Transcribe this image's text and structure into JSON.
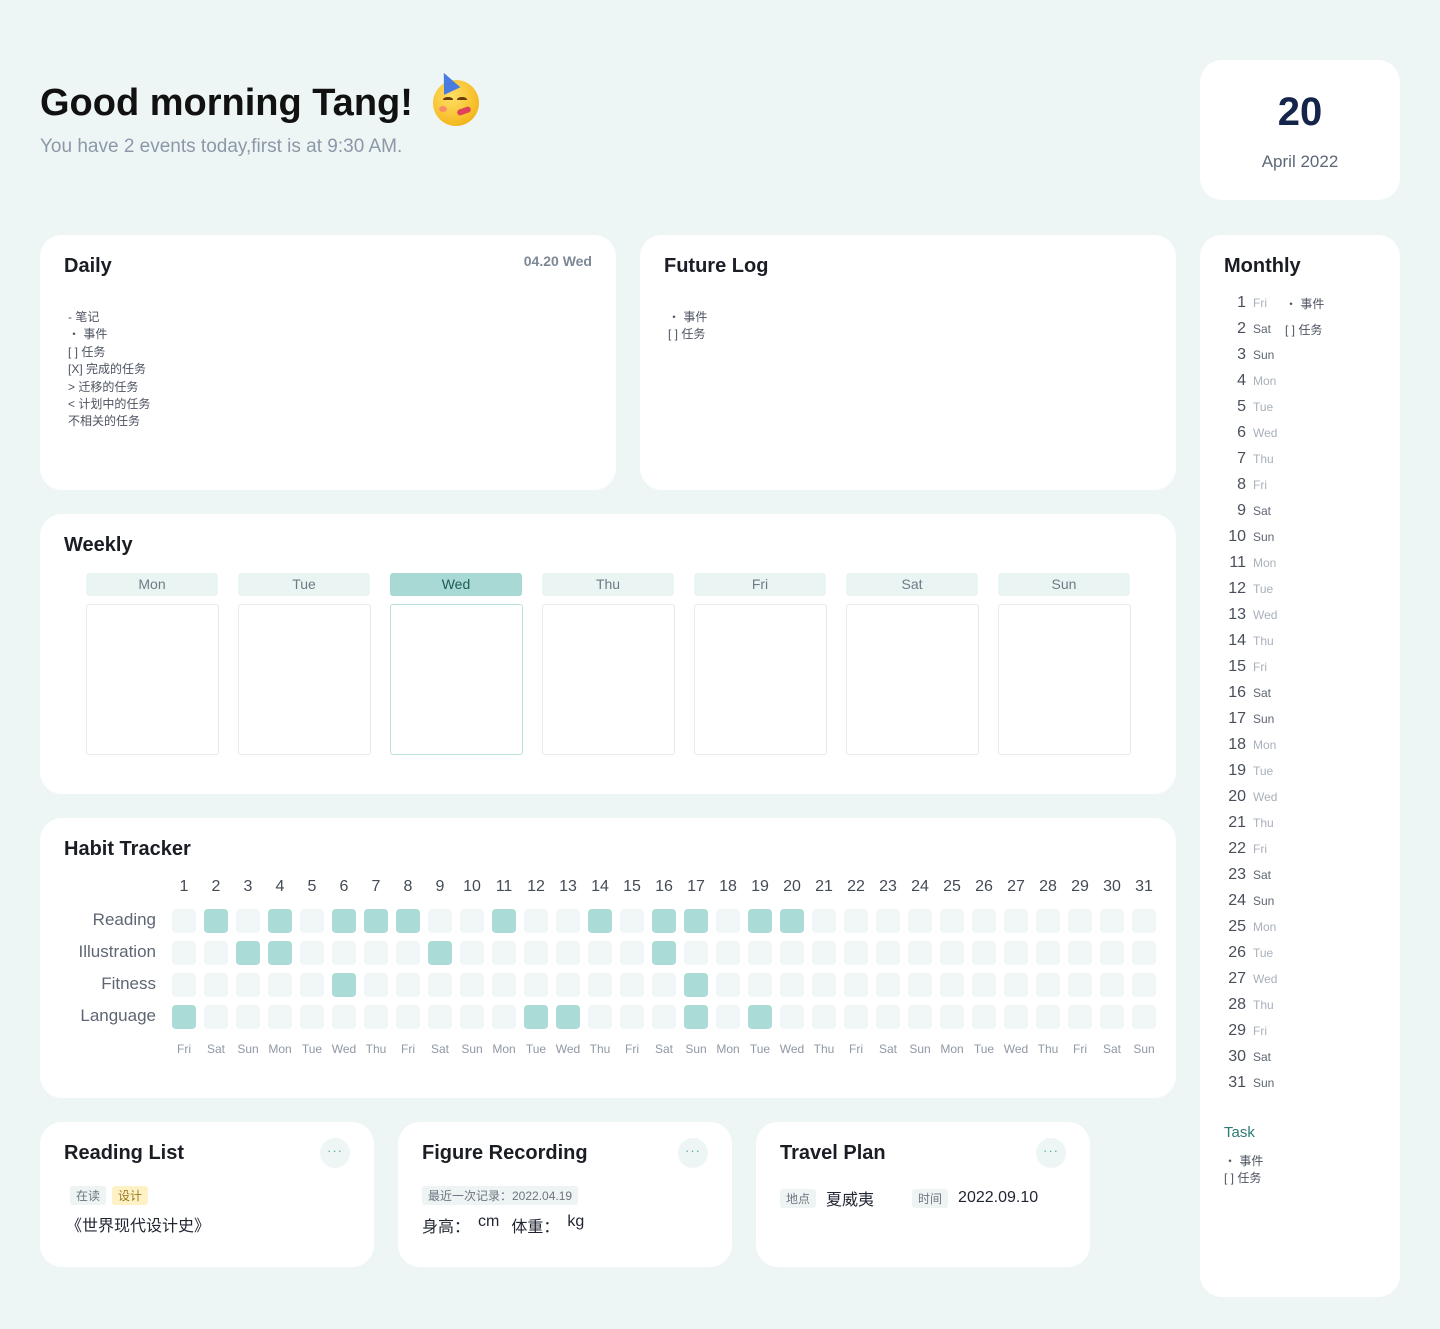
{
  "header": {
    "greeting": "Good morning Tang!",
    "subtitle": "You have 2 events today,first is at 9:30 AM.",
    "emoji": "partying-face"
  },
  "date_card": {
    "day": "20",
    "month": "April 2022"
  },
  "daily": {
    "title": "Daily",
    "date": "04.20 Wed",
    "lines": [
      "- 笔记",
      "・ 事件",
      "[ ] 任务",
      "[X] 完成的任务",
      "> 迁移的任务",
      "< 计划中的任务",
      "不相关的任务"
    ]
  },
  "future_log": {
    "title": "Future Log",
    "lines": [
      "・ 事件",
      "[ ] 任务"
    ]
  },
  "weekly": {
    "title": "Weekly",
    "days": [
      "Mon",
      "Tue",
      "Wed",
      "Thu",
      "Fri",
      "Sat",
      "Sun"
    ],
    "active_index": 2
  },
  "habit_tracker": {
    "title": "Habit Tracker",
    "day_numbers": [
      "1",
      "2",
      "3",
      "4",
      "5",
      "6",
      "7",
      "8",
      "9",
      "10",
      "11",
      "12",
      "13",
      "14",
      "15",
      "16",
      "17",
      "18",
      "19",
      "20",
      "21",
      "22",
      "23",
      "24",
      "25",
      "26",
      "27",
      "28",
      "29",
      "30",
      "31"
    ],
    "weekdays": [
      "Fri",
      "Sat",
      "Sun",
      "Mon",
      "Tue",
      "Wed",
      "Thu",
      "Fri",
      "Sat",
      "Sun",
      "Mon",
      "Tue",
      "Wed",
      "Thu",
      "Fri",
      "Sat",
      "Sun",
      "Mon",
      "Tue",
      "Wed",
      "Thu",
      "Fri",
      "Sat",
      "Sun",
      "Mon",
      "Tue",
      "Wed",
      "Thu",
      "Fri",
      "Sat",
      "Sun"
    ],
    "habits": [
      {
        "name": "Reading",
        "done_days": [
          2,
          4,
          6,
          7,
          8,
          11,
          14,
          16,
          17,
          19,
          20
        ]
      },
      {
        "name": "Illustration",
        "done_days": [
          3,
          4,
          9,
          16
        ]
      },
      {
        "name": "Fitness",
        "done_days": [
          6,
          17
        ]
      },
      {
        "name": "Language",
        "done_days": [
          1,
          12,
          13,
          17,
          19
        ]
      }
    ],
    "colors": {
      "done": "#abdbd7",
      "empty": "#f0f7f6"
    }
  },
  "reading_list": {
    "title": "Reading List",
    "more": "···",
    "tag_status": "在读",
    "tag_category": "设计",
    "book": "《世界现代设计史》"
  },
  "figure_recording": {
    "title": "Figure Recording",
    "more": "···",
    "last_record": "最近一次记录：2022.04.19",
    "height_label": "身高：",
    "height_unit": "cm",
    "weight_label": "体重：",
    "weight_unit": "kg"
  },
  "travel_plan": {
    "title": "Travel Plan",
    "more": "···",
    "place_label": "地点",
    "place": "夏威夷",
    "time_label": "时间",
    "time": "2022.09.10"
  },
  "monthly": {
    "title": "Monthly",
    "days": [
      {
        "n": "1",
        "w": "Fri",
        "note": "・ 事件"
      },
      {
        "n": "2",
        "w": "Sat",
        "note": "[ ] 任务"
      },
      {
        "n": "3",
        "w": "Sun"
      },
      {
        "n": "4",
        "w": "Mon"
      },
      {
        "n": "5",
        "w": "Tue"
      },
      {
        "n": "6",
        "w": "Wed"
      },
      {
        "n": "7",
        "w": "Thu"
      },
      {
        "n": "8",
        "w": "Fri"
      },
      {
        "n": "9",
        "w": "Sat"
      },
      {
        "n": "10",
        "w": "Sun"
      },
      {
        "n": "11",
        "w": "Mon"
      },
      {
        "n": "12",
        "w": "Tue"
      },
      {
        "n": "13",
        "w": "Wed"
      },
      {
        "n": "14",
        "w": "Thu"
      },
      {
        "n": "15",
        "w": "Fri"
      },
      {
        "n": "16",
        "w": "Sat"
      },
      {
        "n": "17",
        "w": "Sun"
      },
      {
        "n": "18",
        "w": "Mon"
      },
      {
        "n": "19",
        "w": "Tue"
      },
      {
        "n": "20",
        "w": "Wed"
      },
      {
        "n": "21",
        "w": "Thu"
      },
      {
        "n": "22",
        "w": "Fri"
      },
      {
        "n": "23",
        "w": "Sat"
      },
      {
        "n": "24",
        "w": "Sun"
      },
      {
        "n": "25",
        "w": "Mon"
      },
      {
        "n": "26",
        "w": "Tue"
      },
      {
        "n": "27",
        "w": "Wed"
      },
      {
        "n": "28",
        "w": "Thu"
      },
      {
        "n": "29",
        "w": "Fri"
      },
      {
        "n": "30",
        "w": "Sat"
      },
      {
        "n": "31",
        "w": "Sun"
      }
    ],
    "task_title": "Task",
    "task_lines": [
      "・ 事件",
      "[ ] 任务"
    ]
  }
}
